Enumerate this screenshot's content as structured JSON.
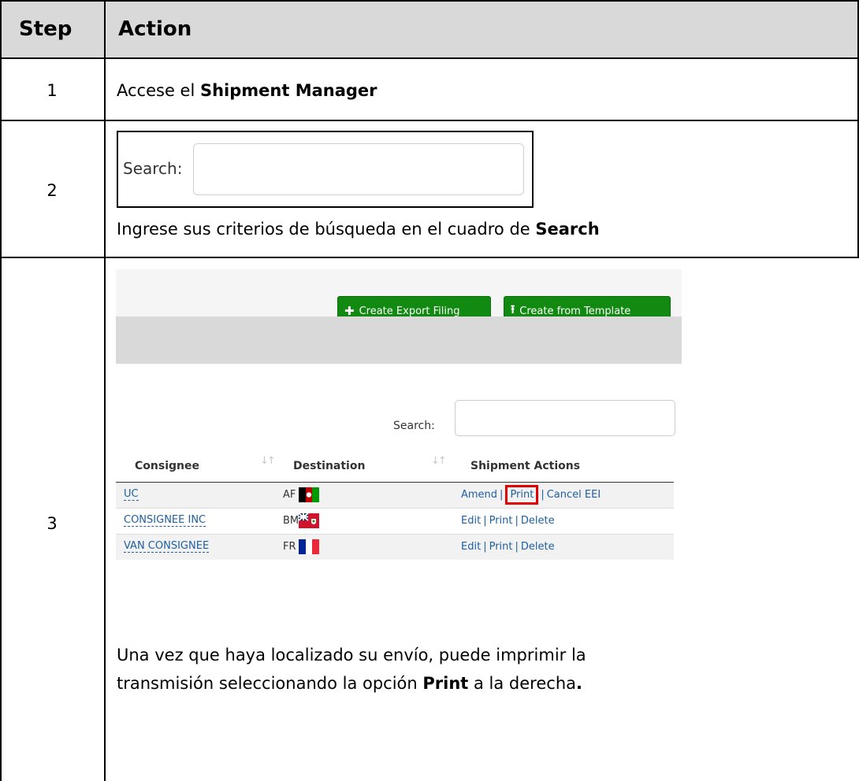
{
  "table": {
    "header": {
      "step": "Step",
      "action": "Action"
    },
    "rows": [
      {
        "step": "1",
        "text_prefix": "Accese el ",
        "text_bold": "Shipment Manager"
      },
      {
        "step": "2",
        "image_search_label": "Search:",
        "text_prefix": "Ingrese sus criterios de búsqueda en el cuadro de ",
        "text_bold": "Search"
      },
      {
        "step": "3",
        "text_line1": "Una vez que haya localizado su envío, puede imprimir la",
        "text_line2_prefix": "transmisión seleccionando la opción ",
        "text_line2_bold": "Print",
        "text_line2_suffix": " a la derecha",
        "text_line2_end": "."
      }
    ]
  },
  "screenshot": {
    "buttons": {
      "create_export": "Create Export Filing",
      "create_template": "Create from Template"
    },
    "search_label": "Search:",
    "columns": {
      "consignee": "Consignee",
      "destination": "Destination",
      "actions": "Shipment Actions"
    },
    "rows": [
      {
        "consignee": "UC",
        "dest": "AF",
        "flag": "afghanistan-flag-icon",
        "a1": "Amend",
        "a2": "Print",
        "a3": "Cancel EEI"
      },
      {
        "consignee": "CONSIGNEE INC",
        "dest": "BM",
        "flag": "bermuda-flag-icon",
        "a1": "Edit",
        "a2": "Print",
        "a3": "Delete"
      },
      {
        "consignee": "VAN CONSIGNEE",
        "dest": "FR",
        "flag": "france-flag-icon",
        "a1": "Edit",
        "a2": "Print",
        "a3": "Delete"
      }
    ],
    "colors": {
      "button_green": "#128a12",
      "link_blue": "#1f5fa0",
      "highlight_red": "#e00000"
    }
  }
}
